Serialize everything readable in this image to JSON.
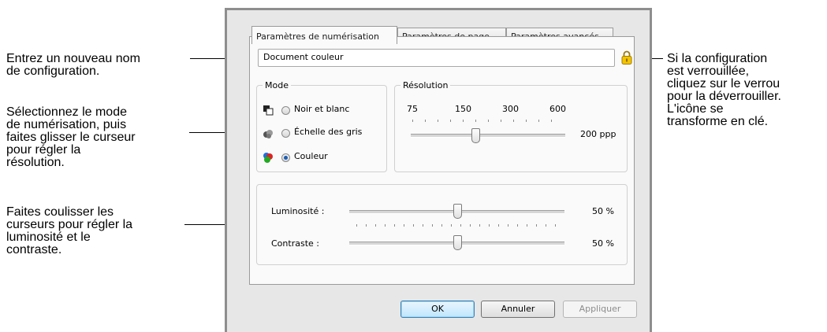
{
  "annotations": {
    "config_name": [
      "Entrez un nouveau nom",
      "de configuration."
    ],
    "mode": [
      "Sélectionnez le mode",
      "de numérisation, puis",
      "faites glisser le curseur",
      "pour régler la",
      "résolution."
    ],
    "sliders": [
      "Faites coulisser les",
      "curseurs pour régler la",
      "luminosité et le",
      "contraste."
    ],
    "lock": [
      "Si la configuration",
      "est verrouillée,",
      "cliquez sur le verrou",
      "pour la déverrouiller.",
      "L'icône se",
      "transforme en clé."
    ]
  },
  "tabs": [
    "Paramètres de numérisation",
    "Paramètres de page",
    "Paramètres avancés"
  ],
  "config_name_value": "Document couleur",
  "mode": {
    "label": "Mode",
    "options": [
      "Noir et blanc",
      "Échelle des gris",
      "Couleur"
    ],
    "selected": "Couleur"
  },
  "resolution": {
    "label": "Résolution",
    "ticks": [
      "75",
      "150",
      "300",
      "600"
    ],
    "value_text": "200 ppp",
    "value": 200
  },
  "brightness": {
    "label": "Luminosité :",
    "value_text": "50 %",
    "value": 50
  },
  "contrast": {
    "label": "Contraste :",
    "value_text": "50 %",
    "value": 50
  },
  "buttons": {
    "ok": "OK",
    "cancel": "Annuler",
    "apply": "Appliquer"
  },
  "colors": {
    "default_button": "#bee6fd",
    "radio_selected": "#1a5db3",
    "lock": "#e8b400"
  }
}
